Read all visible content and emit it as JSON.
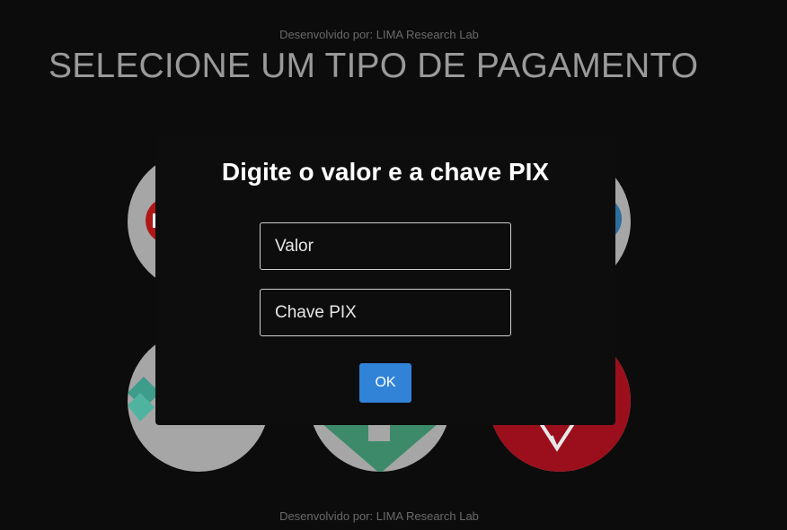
{
  "header": {
    "credit": "Desenvolvido por: LIMA Research Lab",
    "title": "SELECIONE UM TIPO DE PAGAMENTO"
  },
  "footer": {
    "credit": "Desenvolvido por: LIMA Research Lab"
  },
  "payment_options": [
    {
      "icon": "red-card-logo-icon",
      "color": "#b01818"
    },
    {
      "icon": "blue-globe-logo-icon",
      "color": "#2c6e9e"
    },
    {
      "icon": "pix-logo-icon",
      "color": "#3d9c8a"
    },
    {
      "icon": "green-tag-logo-icon",
      "color": "#3d8a6a"
    },
    {
      "icon": "red-arrow-logo-icon",
      "color": "#9b0f1c"
    }
  ],
  "modal": {
    "title": "Digite o valor e a chave PIX",
    "valor_placeholder": "Valor",
    "chave_placeholder": "Chave PIX",
    "ok_label": "OK",
    "button_color": "#3183d8"
  }
}
